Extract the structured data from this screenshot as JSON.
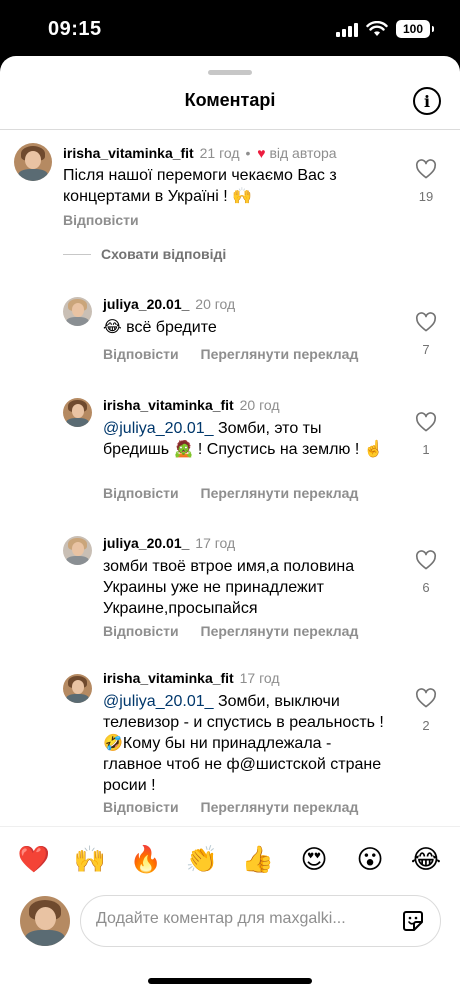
{
  "status_bar": {
    "time": "09:15",
    "battery": "100"
  },
  "header": {
    "title": "Коментарі"
  },
  "main_comment": {
    "username": "irisha_vitaminka_fit",
    "time": "21 год",
    "author_label": "від автора",
    "text": "Після нашої перемоги чекаємо Вас з концертами в Україні ! 🙌",
    "reply_label": "Відповісти",
    "likes": "19"
  },
  "hide_replies_label": "Сховати відповіді",
  "replies": [
    {
      "username": "juliya_20.01_",
      "time": "20 год",
      "mention": "",
      "text": "😂 всё бредите",
      "reply_label": "Відповісти",
      "translate_label": "Переглянути переклад",
      "likes": "7"
    },
    {
      "username": "irisha_vitaminka_fit",
      "time": "20 год",
      "mention": "@juliya_20.01_",
      "text": " Зомби, это ты бредишь 🧟 ! Спустись на землю ! ☝️",
      "reply_label": "Відповісти",
      "translate_label": "Переглянути переклад",
      "likes": "1"
    },
    {
      "username": "juliya_20.01_",
      "time": "17 год",
      "mention": "",
      "text": "зомби твоё втрое имя,а половина Украины уже не принадлежит Украине,просыпайся",
      "reply_label": "Відповісти",
      "translate_label": "Переглянути переклад",
      "likes": "6"
    },
    {
      "username": "irisha_vitaminka_fit",
      "time": "17 год",
      "mention": "@juliya_20.01_",
      "text": " Зомби, выключи телевизор - и спустись в реальность ! 🤣Кому бы ни принадлежала - главное чтоб не ф@шистской стране росии !",
      "reply_label": "Відповісти",
      "translate_label": "Переглянути переклад",
      "likes": "2"
    }
  ],
  "reactions": [
    "❤️",
    "🙌",
    "🔥",
    "👏",
    "👍",
    "😍",
    "😮",
    "😂"
  ],
  "composer": {
    "placeholder": "Додайте коментар для maxgalki..."
  }
}
